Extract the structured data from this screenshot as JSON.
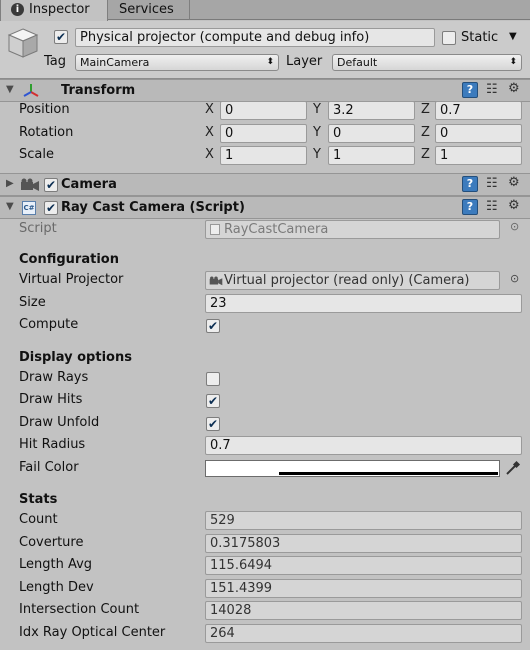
{
  "tabs": {
    "inspector": "Inspector",
    "services": "Services"
  },
  "header": {
    "object_name": "Physical projector (compute and debug info)",
    "static_label": "Static",
    "tag_label": "Tag",
    "tag_value": "MainCamera",
    "layer_label": "Layer",
    "layer_value": "Default"
  },
  "transform": {
    "title": "Transform",
    "position_label": "Position",
    "rotation_label": "Rotation",
    "scale_label": "Scale",
    "axis_x": "X",
    "axis_y": "Y",
    "axis_z": "Z",
    "position": {
      "x": "0",
      "y": "3.2",
      "z": "0.7"
    },
    "rotation": {
      "x": "0",
      "y": "0",
      "z": "0"
    },
    "scale": {
      "x": "1",
      "y": "1",
      "z": "1"
    }
  },
  "camera": {
    "title": "Camera"
  },
  "raycast": {
    "title": "Ray Cast Camera (Script)",
    "script_label": "Script",
    "script_value": "RayCastCamera",
    "configuration_heading": "Configuration",
    "virtual_projector_label": "Virtual Projector",
    "virtual_projector_value": "Virtual projector (read only) (Camera)",
    "size_label": "Size",
    "size_value": "23",
    "compute_label": "Compute",
    "display_heading": "Display options",
    "draw_rays_label": "Draw Rays",
    "draw_hits_label": "Draw Hits",
    "draw_unfold_label": "Draw Unfold",
    "hit_radius_label": "Hit Radius",
    "hit_radius_value": "0.7",
    "fail_color_label": "Fail Color",
    "stats_heading": "Stats",
    "count_label": "Count",
    "count_value": "529",
    "coverture_label": "Coverture",
    "coverture_value": "0.3175803",
    "length_avg_label": "Length Avg",
    "length_avg_value": "115.6494",
    "length_dev_label": "Length Dev",
    "length_dev_value": "151.4399",
    "intersection_label": "Intersection Count",
    "intersection_value": "14028",
    "idx_ray_label": "Idx Ray Optical Center",
    "idx_ray_value": "264"
  },
  "checks": {
    "active": true,
    "static": false,
    "camera_enabled": true,
    "raycast_enabled": true,
    "compute": true,
    "draw_rays": false,
    "draw_hits": true,
    "draw_unfold": true
  },
  "icons": {
    "info": "info-icon",
    "cube": "cube-icon",
    "transform": "transform-axes-icon",
    "camera": "camera-icon",
    "script": "script-icon",
    "help": "help-icon",
    "preset": "preset-icon",
    "gear": "gear-icon",
    "eyedropper": "eyedropper-icon",
    "target": "object-picker-icon"
  },
  "colors": {
    "fail_color": "#ffffff",
    "help_icon": "#3c7bbd"
  }
}
